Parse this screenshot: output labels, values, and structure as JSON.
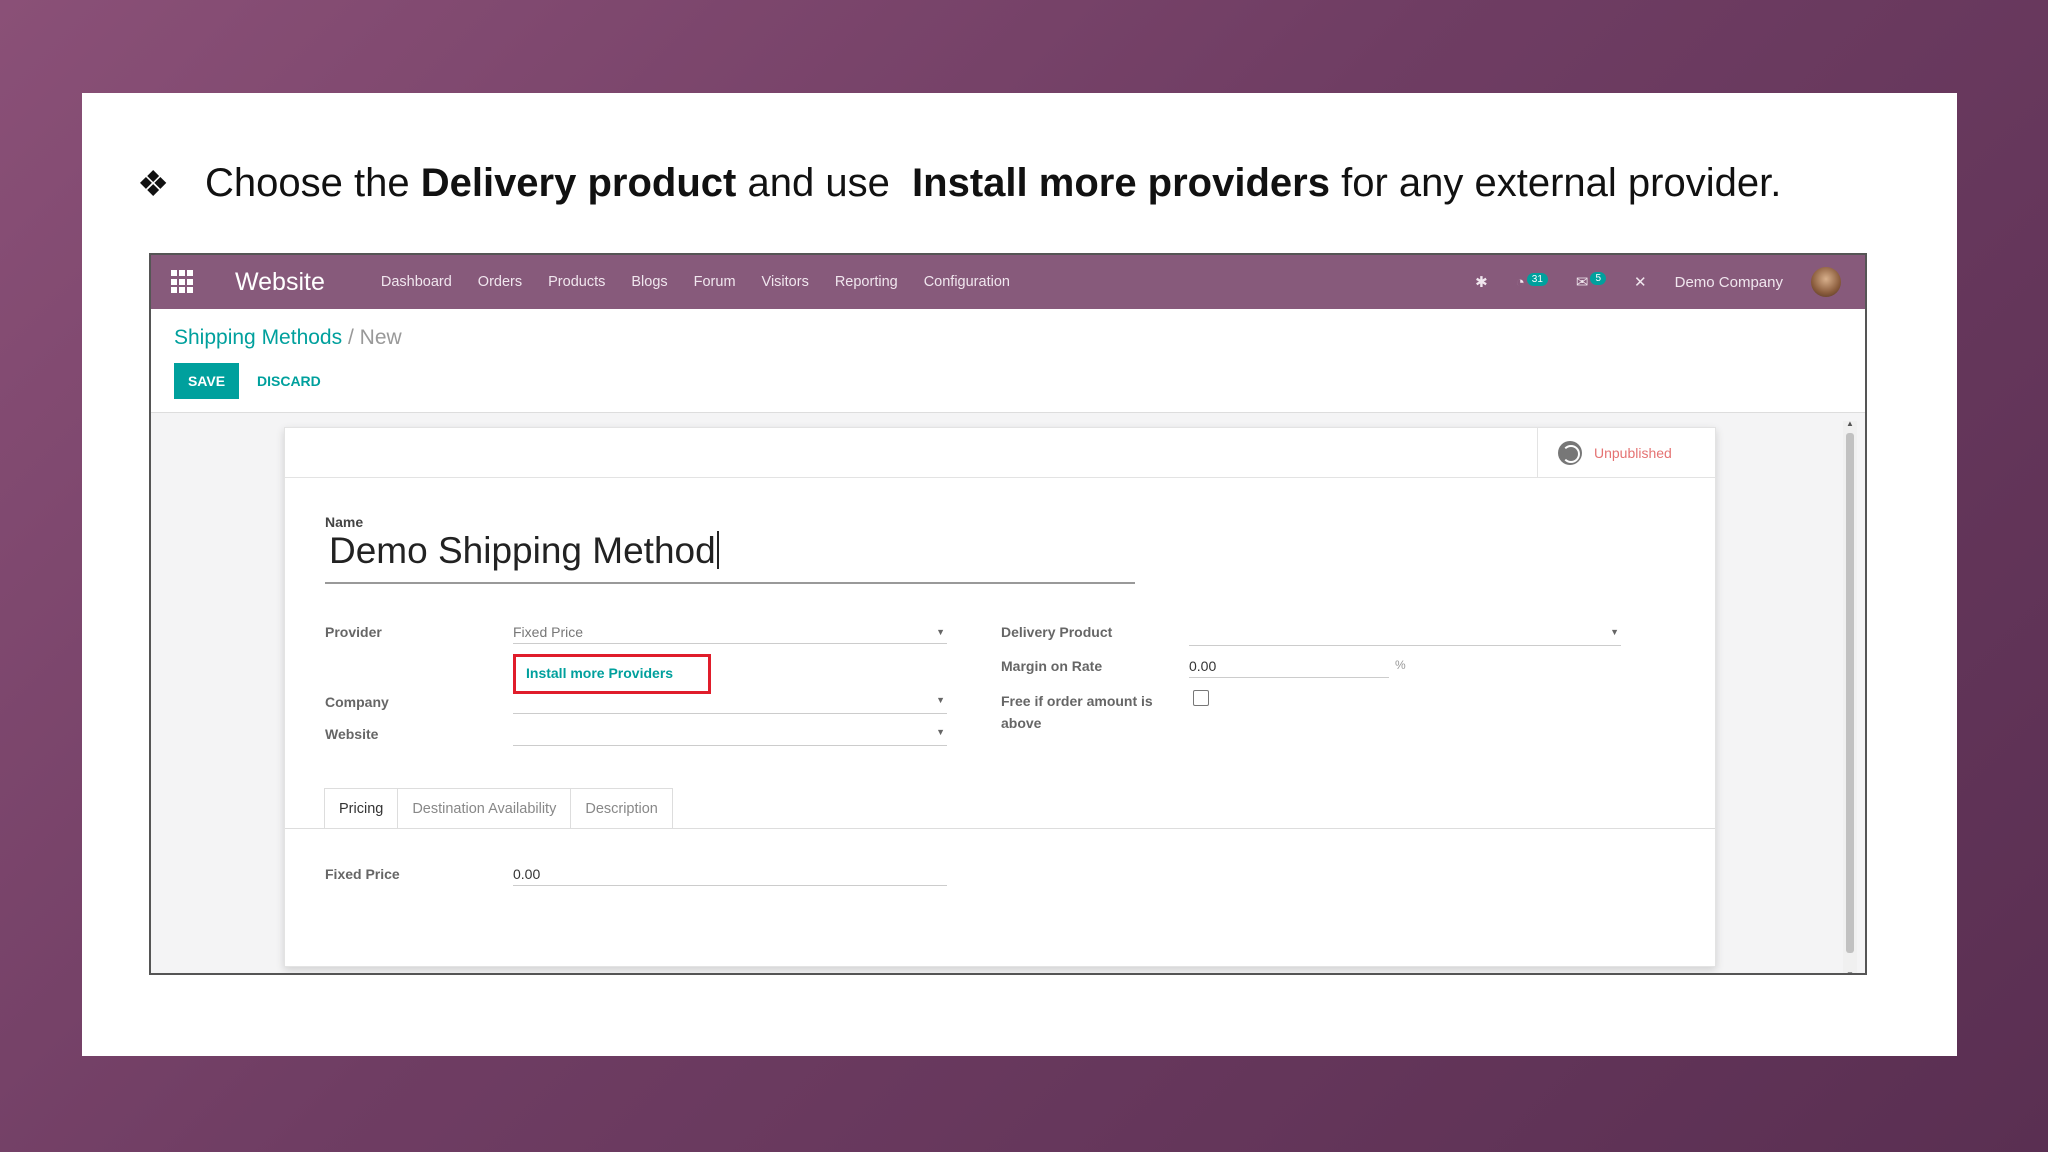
{
  "instruction": {
    "bullet": "❖",
    "part1": "Choose the ",
    "bold1": "Delivery product",
    "part2": " and use  ",
    "bold2": "Install more providers",
    "part3": " for any external provider."
  },
  "navbar": {
    "brand": "Website",
    "menu": [
      "Dashboard",
      "Orders",
      "Products",
      "Blogs",
      "Forum",
      "Visitors",
      "Reporting",
      "Configuration"
    ],
    "activity_count": "31",
    "message_count": "5",
    "company": "Demo Company"
  },
  "breadcrumb": {
    "parent": "Shipping Methods",
    "separator": "/",
    "current": "New"
  },
  "buttons": {
    "save": "SAVE",
    "discard": "DISCARD"
  },
  "status": {
    "publish": "Unpublished"
  },
  "form": {
    "name_label": "Name",
    "name_value": "Demo Shipping Method",
    "provider_label": "Provider",
    "provider_value": "Fixed Price",
    "install_link": "Install more Providers",
    "company_label": "Company",
    "company_value": "",
    "website_label": "Website",
    "website_value": "",
    "delivery_product_label": "Delivery Product",
    "delivery_product_value": "",
    "margin_label": "Margin on Rate",
    "margin_value": "0.00",
    "margin_unit": "%",
    "free_label_line1": "Free if order amount is",
    "free_label_line2": "above",
    "free_checked": false
  },
  "tabs": [
    "Pricing",
    "Destination Availability",
    "Description"
  ],
  "pricing": {
    "fixed_price_label": "Fixed Price",
    "fixed_price_value": "0.00"
  },
  "colors": {
    "navbar": "#875a7b",
    "accent": "#00a09d",
    "highlight_box": "#e01d2b",
    "unpublished": "#e57373"
  }
}
